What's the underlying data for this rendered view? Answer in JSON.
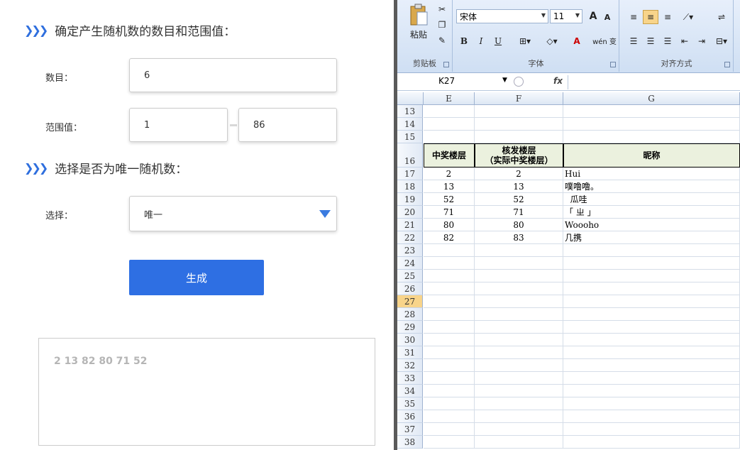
{
  "form": {
    "section1_title": "确定产生随机数的数目和范围值：",
    "count_label": "数目：",
    "count_value": "6",
    "range_label": "范围值：",
    "range_min": "1",
    "range_max": "86",
    "section2_title": "选择是否为唯一随机数：",
    "choice_label": "选择：",
    "choice_value": "唯一",
    "generate_label": "生成",
    "result": "2 13 82 80 71 52",
    "arrows": "❯❯❯"
  },
  "excel": {
    "clipboard": {
      "paste_label": "粘贴",
      "group_name": "剪贴板"
    },
    "font": {
      "font_name": "宋体",
      "font_size": "11",
      "group_name": "字体",
      "bold": "B",
      "italic": "I",
      "underline": "U",
      "grow": "A",
      "shrink": "A",
      "font_color": "A",
      "phonetic": "wén 变"
    },
    "alignment": {
      "group_name": "对齐方式"
    },
    "name_box": "K27",
    "fx": "fx",
    "columns": [
      "E",
      "F",
      "G"
    ],
    "header_row": {
      "row": "16",
      "e": "中奖楼层",
      "f": "核发楼层\n（实际中奖楼层）",
      "g": "昵称"
    },
    "rows": [
      {
        "row": "13",
        "e": "",
        "f": "",
        "g": ""
      },
      {
        "row": "14",
        "e": "",
        "f": "",
        "g": ""
      },
      {
        "row": "15",
        "e": "",
        "f": "",
        "g": ""
      },
      {
        "row": "17",
        "e": "2",
        "f": "2",
        "g": "Hui"
      },
      {
        "row": "18",
        "e": "13",
        "f": "13",
        "g": "噗噜噜。"
      },
      {
        "row": "19",
        "e": "52",
        "f": "52",
        "g": "  瓜哇"
      },
      {
        "row": "20",
        "e": "71",
        "f": "71",
        "g": "「 ㄓ 」"
      },
      {
        "row": "21",
        "e": "80",
        "f": "80",
        "g": "Woooho"
      },
      {
        "row": "22",
        "e": "82",
        "f": "83",
        "g": "几携"
      },
      {
        "row": "23",
        "e": "",
        "f": "",
        "g": ""
      },
      {
        "row": "24",
        "e": "",
        "f": "",
        "g": ""
      },
      {
        "row": "25",
        "e": "",
        "f": "",
        "g": ""
      },
      {
        "row": "26",
        "e": "",
        "f": "",
        "g": ""
      },
      {
        "row": "27",
        "e": "",
        "f": "",
        "g": ""
      },
      {
        "row": "28",
        "e": "",
        "f": "",
        "g": ""
      },
      {
        "row": "29",
        "e": "",
        "f": "",
        "g": ""
      },
      {
        "row": "30",
        "e": "",
        "f": "",
        "g": ""
      },
      {
        "row": "31",
        "e": "",
        "f": "",
        "g": ""
      },
      {
        "row": "32",
        "e": "",
        "f": "",
        "g": ""
      },
      {
        "row": "33",
        "e": "",
        "f": "",
        "g": ""
      },
      {
        "row": "34",
        "e": "",
        "f": "",
        "g": ""
      },
      {
        "row": "35",
        "e": "",
        "f": "",
        "g": ""
      },
      {
        "row": "36",
        "e": "",
        "f": "",
        "g": ""
      },
      {
        "row": "37",
        "e": "",
        "f": "",
        "g": ""
      },
      {
        "row": "38",
        "e": "",
        "f": "",
        "g": ""
      }
    ],
    "selected_row": "27"
  },
  "colors": {
    "accent": "#2e6fe3",
    "header_fill": "#ebf1de",
    "selected_row": "#f8d48a"
  }
}
